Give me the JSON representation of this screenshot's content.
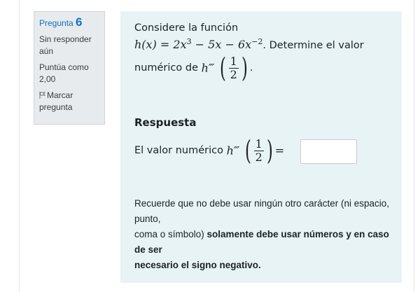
{
  "question_info": {
    "label": "Pregunta",
    "number": "6",
    "status": "Sin responder aún",
    "grade_line1": "Puntúa como",
    "grade_line2": "2,00",
    "flag_label": "Marcar pregunta"
  },
  "question": {
    "intro": "Considere la función",
    "func_lhs": "h(x)",
    "func_rhs_a": " = 2x",
    "exp_3": "3",
    "func_rhs_b": " − 5x − 6x",
    "exp_neg2": "−2",
    "after_func": ". Determine el valor",
    "line3_text": "numérico de ",
    "hppp": "h‴",
    "frac_num": "1",
    "frac_den": "2",
    "period": "."
  },
  "response": {
    "title": "Respuesta",
    "prefix": "El valor numérico ",
    "equals": "=",
    "input_value": ""
  },
  "note": {
    "normal_1": "Recuerde que no debe usar ningún otro carácter (ni espacio, punto,",
    "normal_2": "coma o símbolo) ",
    "bold_1": "solamente debe usar números y en caso de ser",
    "bold_2": "necesario el signo negativo."
  }
}
